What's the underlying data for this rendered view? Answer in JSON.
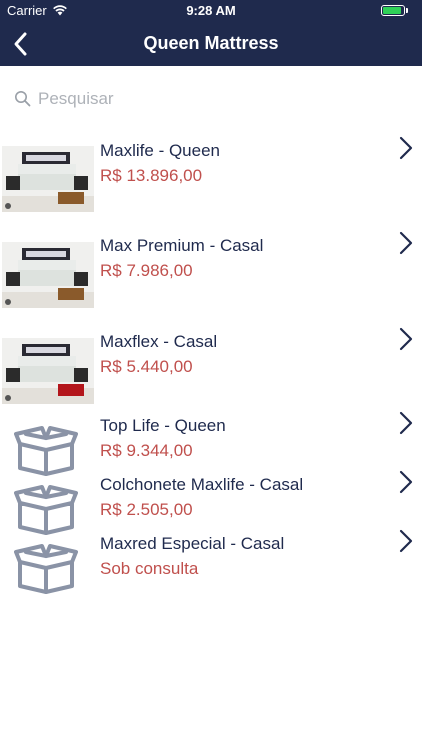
{
  "status_bar": {
    "carrier": "Carrier",
    "time": "9:28 AM",
    "battery_level": 0.9
  },
  "nav": {
    "title": "Queen Mattress",
    "back_icon": "chevron-left-icon"
  },
  "search": {
    "placeholder": "Pesquisar",
    "value": ""
  },
  "products": [
    {
      "name": "Maxlife - Queen",
      "price": "R$ 13.896,00",
      "image": "bedroom-photo",
      "rug_color": "#8a5a2b"
    },
    {
      "name": "Max Premium - Casal",
      "price": "R$ 7.986,00",
      "image": "bedroom-photo",
      "rug_color": "#8a5a2b"
    },
    {
      "name": "Maxflex - Casal",
      "price": "R$ 5.440,00",
      "image": "bedroom-photo",
      "rug_color": "#b3151b"
    },
    {
      "name": "Top Life - Queen",
      "price": "R$ 9.344,00",
      "image": "open-box-icon"
    },
    {
      "name": "Colchonete Maxlife - Casal",
      "price": "R$ 2.505,00",
      "image": "open-box-icon"
    },
    {
      "name": "Maxred Especial - Casal",
      "price": "Sob consulta",
      "image": "open-box-icon"
    }
  ],
  "colors": {
    "nav_bg": "#1f2a4d",
    "price": "#c0504d",
    "name": "#1f2a4d",
    "icon_gray": "#8a93a6"
  }
}
